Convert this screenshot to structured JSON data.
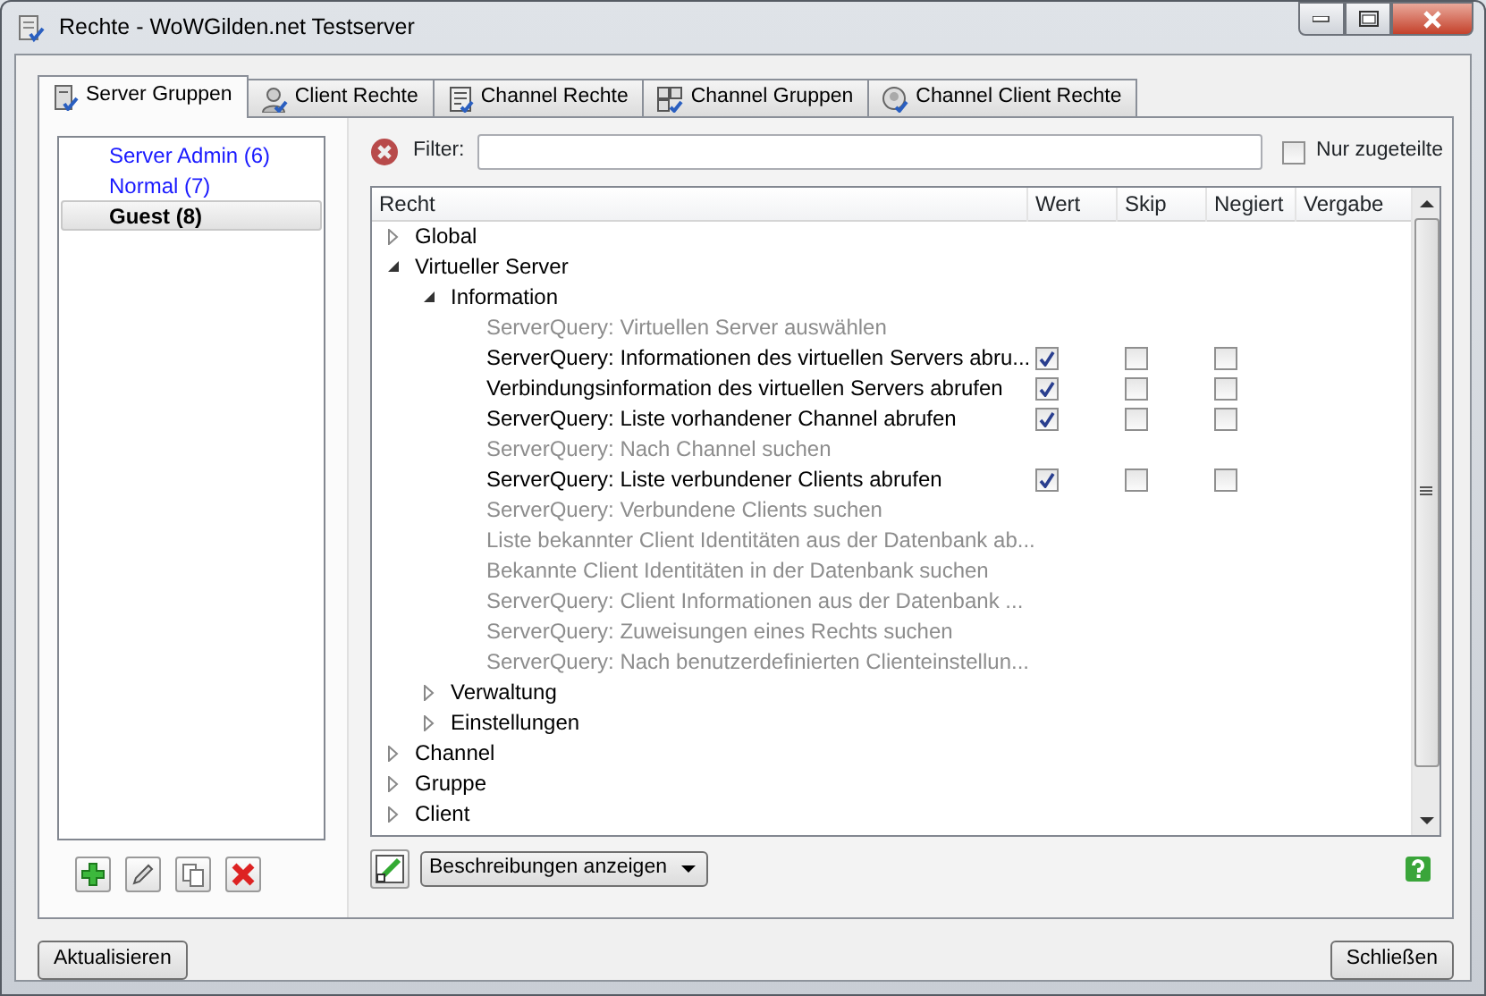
{
  "window": {
    "title": "Rechte - WoWGilden.net Testserver"
  },
  "tabs": [
    {
      "label": "Server Gruppen",
      "selected": true
    },
    {
      "label": "Client Rechte",
      "selected": false
    },
    {
      "label": "Channel Rechte",
      "selected": false
    },
    {
      "label": "Channel Gruppen",
      "selected": false
    },
    {
      "label": "Channel Client Rechte",
      "selected": false
    }
  ],
  "groups": [
    {
      "label": "Server Admin (6)",
      "selected": false
    },
    {
      "label": "Normal (7)",
      "selected": false
    },
    {
      "label": "Guest (8)",
      "selected": true
    }
  ],
  "filter": {
    "label": "Filter:",
    "only_assigned": {
      "label": "Nur zugeteilte",
      "checked": false
    }
  },
  "table": {
    "columns": [
      "Recht",
      "Wert",
      "Skip",
      "Negiert",
      "Vergabe"
    ],
    "tree": [
      {
        "kind": "group",
        "label": "Global",
        "expanded": false
      },
      {
        "kind": "group",
        "label": "Virtueller Server",
        "expanded": true,
        "children": [
          {
            "kind": "group",
            "label": "Information",
            "expanded": true,
            "children": [
              {
                "kind": "permission",
                "label": "ServerQuery: Virtuellen Server auswählen",
                "granted": false
              },
              {
                "kind": "permission",
                "label": "ServerQuery: Informationen des virtuellen Servers abru...",
                "granted": true,
                "wert": true,
                "skip": false,
                "negiert": false
              },
              {
                "kind": "permission",
                "label": "Verbindungsinformation des virtuellen Servers abrufen",
                "granted": true,
                "wert": true,
                "skip": false,
                "negiert": false
              },
              {
                "kind": "permission",
                "label": "ServerQuery: Liste vorhandener Channel abrufen",
                "granted": true,
                "wert": true,
                "skip": false,
                "negiert": false
              },
              {
                "kind": "permission",
                "label": "ServerQuery: Nach Channel suchen",
                "granted": false
              },
              {
                "kind": "permission",
                "label": "ServerQuery: Liste verbundener Clients abrufen",
                "granted": true,
                "wert": true,
                "skip": false,
                "negiert": false
              },
              {
                "kind": "permission",
                "label": "ServerQuery: Verbundene Clients suchen",
                "granted": false
              },
              {
                "kind": "permission",
                "label": "Liste bekannter Client Identitäten aus der Datenbank ab...",
                "granted": false
              },
              {
                "kind": "permission",
                "label": "Bekannte Client Identitäten in der Datenbank suchen",
                "granted": false
              },
              {
                "kind": "permission",
                "label": "ServerQuery: Client Informationen aus der Datenbank ...",
                "granted": false
              },
              {
                "kind": "permission",
                "label": "ServerQuery: Zuweisungen eines Rechts suchen",
                "granted": false
              },
              {
                "kind": "permission",
                "label": "ServerQuery: Nach benutzerdefinierten Clienteinstellun...",
                "granted": false
              }
            ]
          },
          {
            "kind": "group",
            "label": "Verwaltung",
            "expanded": false
          },
          {
            "kind": "group",
            "label": "Einstellungen",
            "expanded": false
          }
        ]
      },
      {
        "kind": "group",
        "label": "Channel",
        "expanded": false
      },
      {
        "kind": "group",
        "label": "Gruppe",
        "expanded": false
      },
      {
        "kind": "group",
        "label": "Client",
        "expanded": false
      }
    ]
  },
  "description_dropdown": {
    "label": "Beschreibungen anzeigen"
  },
  "buttons": {
    "refresh": "Aktualisieren",
    "close": "Schließen"
  }
}
